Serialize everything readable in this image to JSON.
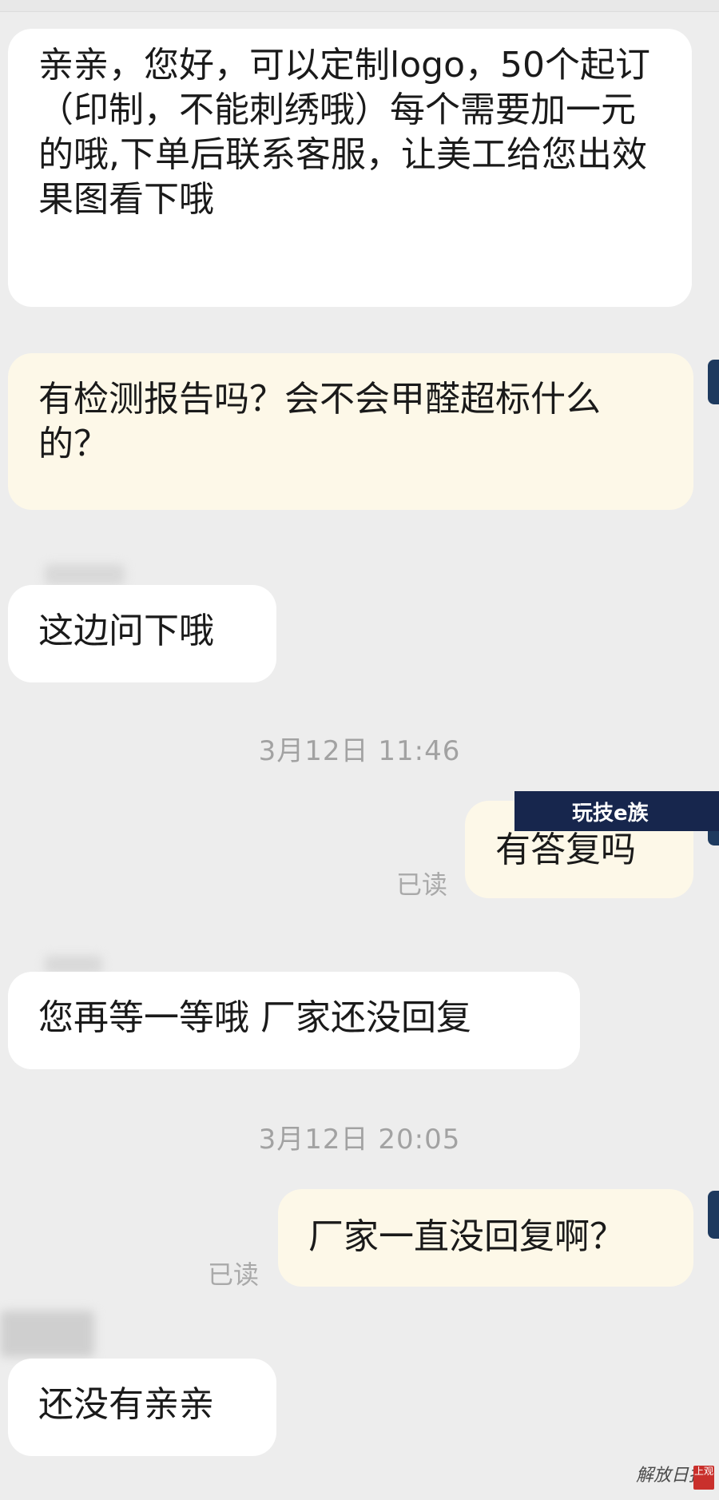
{
  "messages": [
    {
      "text": "亲亲，您好，可以定制logo，50个起订（印制，不能刺绣哦）每个需要加一元的哦,下单后联系客服，让美工给您出效果图看下哦"
    },
    {
      "text": "有检测报告吗？会不会甲醛超标什么的？"
    },
    {
      "text": "这边问下哦"
    },
    {
      "text": "有答复吗"
    },
    {
      "text": "您再等一等哦 厂家还没回复"
    },
    {
      "text": "厂家一直没回复啊？"
    },
    {
      "text": "还没有亲亲"
    }
  ],
  "timestamps": [
    "3月12日 11:46",
    "3月12日 20:05"
  ],
  "read_label": "已读",
  "watermark": {
    "banner": "玩技e族",
    "logo": "解放日报",
    "seal": "上观"
  },
  "colors": {
    "background": "#ededed",
    "incoming_bubble": "#ffffff",
    "outgoing_bubble": "#fdf8e8",
    "banner": "#17264d"
  }
}
